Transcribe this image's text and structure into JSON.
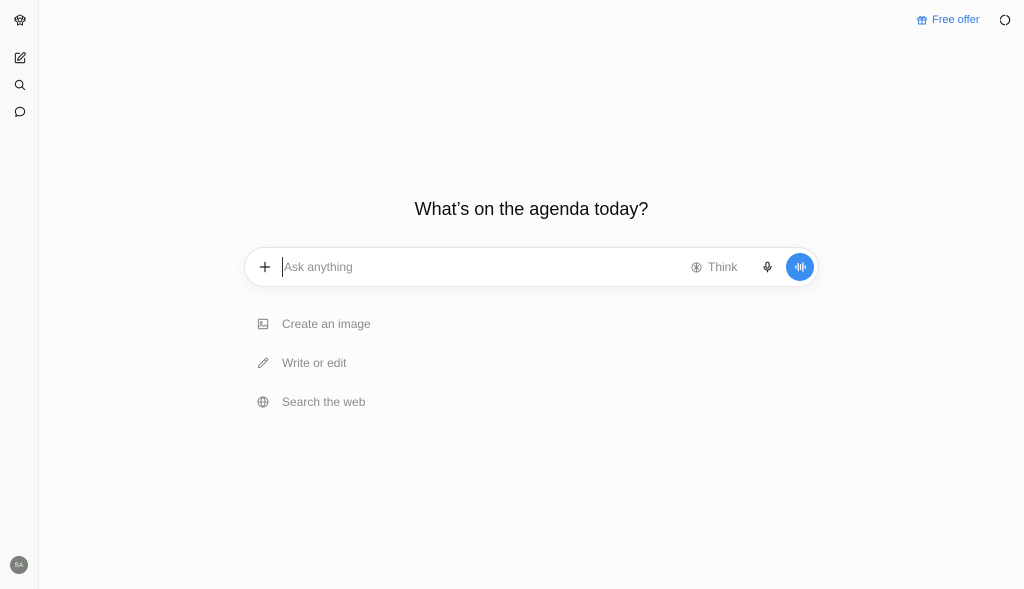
{
  "sidebar": {
    "logo_icon": "openai-logo-icon",
    "items": [
      {
        "name": "new-chat",
        "icon": "edit-icon"
      },
      {
        "name": "search-chats",
        "icon": "search-icon"
      },
      {
        "name": "chats",
        "icon": "chat-bubble-icon"
      }
    ],
    "avatar_initials": "SA"
  },
  "header": {
    "free_offer_label": "Free offer",
    "free_offer_icon": "gift-icon",
    "temporary_chat_icon": "temporary-chat-icon"
  },
  "main": {
    "headline": "What’s on the agenda today?",
    "composer": {
      "placeholder": "Ask anything",
      "value": "",
      "think_label": "Think",
      "accent_color": "#3b8ef0"
    },
    "suggestions": [
      {
        "label": "Create an image",
        "icon": "image-icon"
      },
      {
        "label": "Write or edit",
        "icon": "pencil-icon"
      },
      {
        "label": "Search the web",
        "icon": "globe-icon"
      }
    ]
  },
  "colors": {
    "link": "#2f7de1",
    "muted_text": "#8a8a8a",
    "background": "#fcfcfc"
  }
}
